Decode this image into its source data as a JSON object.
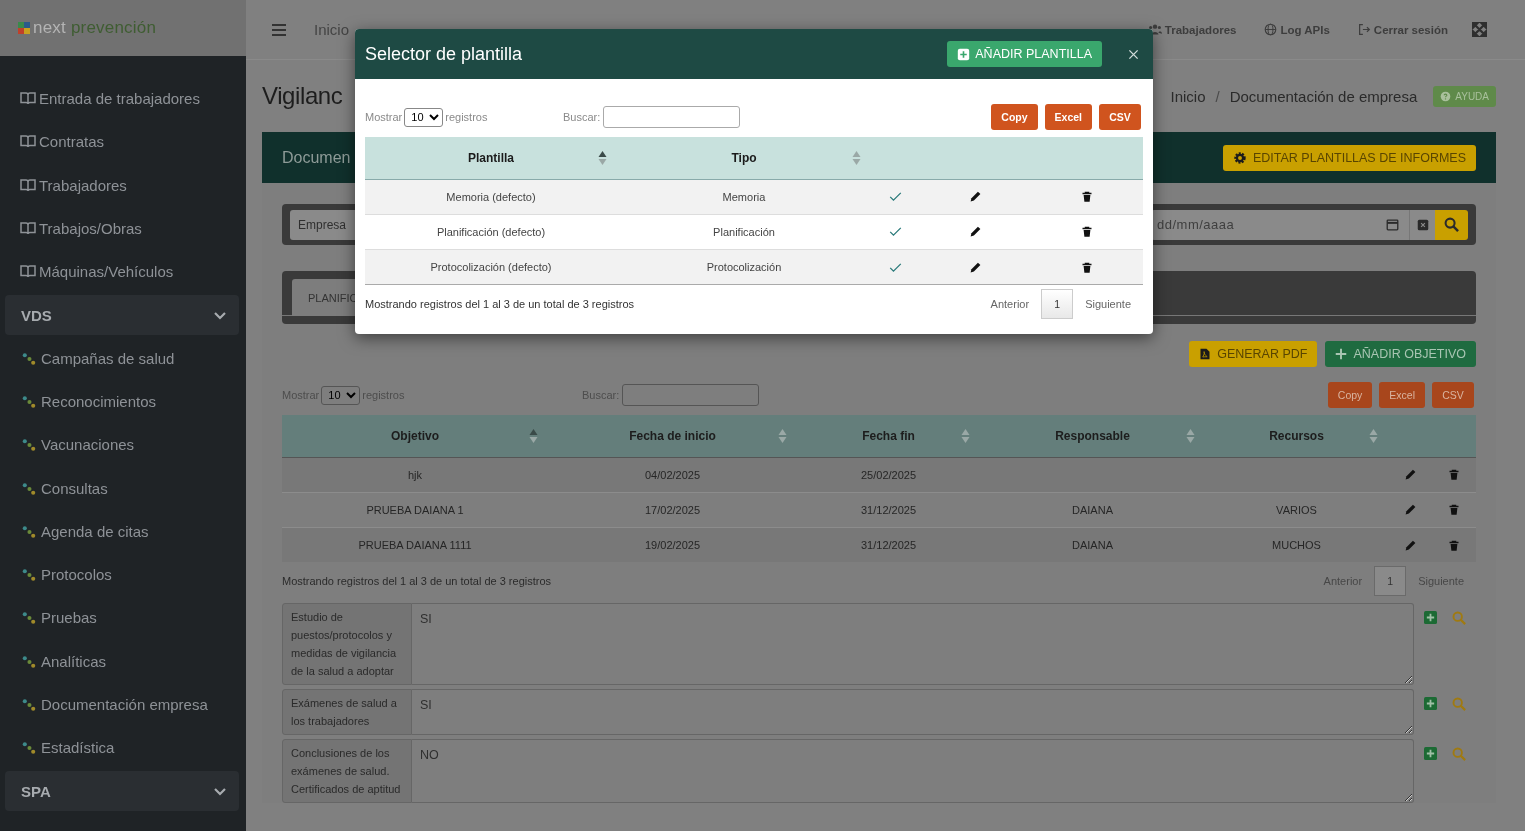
{
  "logo": {
    "part_1": "next",
    "part_2": "prevención"
  },
  "sidebar": {
    "items": [
      {
        "kind": "link",
        "label": "Entrada de trabajadores"
      },
      {
        "kind": "link",
        "label": "Contratas"
      },
      {
        "kind": "link",
        "label": "Trabajadores"
      },
      {
        "kind": "link",
        "label": "Trabajos/Obras"
      },
      {
        "kind": "link",
        "label": "Máquinas/Vehículos"
      },
      {
        "kind": "group",
        "label": "VDS"
      },
      {
        "kind": "sub",
        "label": "Campañas de salud"
      },
      {
        "kind": "sub",
        "label": "Reconocimientos"
      },
      {
        "kind": "sub",
        "label": "Vacunaciones"
      },
      {
        "kind": "sub",
        "label": "Consultas"
      },
      {
        "kind": "sub",
        "label": "Agenda de citas"
      },
      {
        "kind": "sub",
        "label": "Protocolos"
      },
      {
        "kind": "sub",
        "label": "Pruebas"
      },
      {
        "kind": "sub",
        "label": "Analíticas"
      },
      {
        "kind": "sub",
        "label": "Documentación empresa"
      },
      {
        "kind": "sub",
        "label": "Estadística"
      },
      {
        "kind": "group",
        "label": "SPA"
      }
    ]
  },
  "navbar": {
    "home": "Inicio",
    "links": [
      {
        "kind": "users",
        "label": "Trabajadores"
      },
      {
        "kind": "globe",
        "label": "Log APIs"
      },
      {
        "kind": "logout",
        "label": "Cerrar sesión"
      }
    ]
  },
  "page": {
    "title": "Vigilanc",
    "breadcrumb": [
      "Inicio",
      "Documentación de empresa"
    ],
    "breadcrumb_separator": "/",
    "help_button": "AYUDA"
  },
  "card": {
    "title": "Documen",
    "edit_button": "EDITAR PLANTILLAS DE INFORMES",
    "filters": {
      "empresa_placeholder": "Empresa",
      "date_placeholder": "dd/mm/aaaa"
    },
    "tabs": [
      {
        "label": "PLANIFIC",
        "selected": true
      }
    ],
    "actions": [
      {
        "kind": "pdf",
        "label": "GENERAR PDF"
      },
      {
        "kind": "add",
        "label": "AÑADIR OBJETIVO"
      }
    ],
    "table": {
      "show_label": "Mostrar",
      "page_size": "10",
      "records_label": "registros",
      "search_label": "Buscar:",
      "export_buttons": [
        "Copy",
        "Excel",
        "CSV"
      ],
      "columns": [
        {
          "label": "Objetivo",
          "sorted": true
        },
        {
          "label": "Fecha de inicio",
          "sorted": false
        },
        {
          "label": "Fecha fin",
          "sorted": false
        },
        {
          "label": "Responsable",
          "sorted": false
        },
        {
          "label": "Recursos",
          "sorted": false
        }
      ],
      "rows": [
        {
          "cells": [
            "hjk",
            "04/02/2025",
            "25/02/2025",
            "",
            ""
          ]
        },
        {
          "cells": [
            "PRUEBA DAIANA 1",
            "17/02/2025",
            "31/12/2025",
            "DAIANA",
            "VARIOS"
          ]
        },
        {
          "cells": [
            "PRUEBA DAIANA 1111",
            "19/02/2025",
            "31/12/2025",
            "DAIANA",
            "MUCHOS"
          ]
        }
      ],
      "info": "Mostrando registros del 1 al 3 de un total de 3 registros",
      "pagination": {
        "previous": "Anterior",
        "pages": [
          {
            "label": "1",
            "selected": true
          }
        ],
        "next": "Siguiente"
      }
    },
    "fields": [
      {
        "label": "Estudio de puestos/protocolos y medidas de vigilancia de la salud a adoptar",
        "value": "SI"
      },
      {
        "label": "Exámenes de salud a los trabajadores",
        "value": "SI"
      },
      {
        "label": "Conclusiones de los exámenes de salud. Certificados de aptitud",
        "value": "NO"
      }
    ]
  },
  "modal": {
    "title": "Selector de plantilla",
    "add_button": "AÑADIR PLANTILLA",
    "table": {
      "show_label": "Mostrar",
      "page_size": "10",
      "records_label": "registros",
      "search_label": "Buscar:",
      "export_buttons": [
        "Copy",
        "Excel",
        "CSV"
      ],
      "columns": [
        {
          "label": "Plantilla",
          "sorted": true
        },
        {
          "label": "Tipo",
          "sorted": false
        }
      ],
      "rows": [
        {
          "plantilla": "Memoria (defecto)",
          "tipo": "Memoria",
          "active": true
        },
        {
          "plantilla": "Planificación (defecto)",
          "tipo": "Planificación",
          "active": true
        },
        {
          "plantilla": "Protocolización (defecto)",
          "tipo": "Protocolización",
          "active": true
        }
      ],
      "info": "Mostrando registros del 1 al 3 de un total de 3 registros",
      "pagination": {
        "previous": "Anterior",
        "pages": [
          {
            "label": "1",
            "selected": true
          }
        ],
        "next": "Siguiente"
      }
    }
  }
}
